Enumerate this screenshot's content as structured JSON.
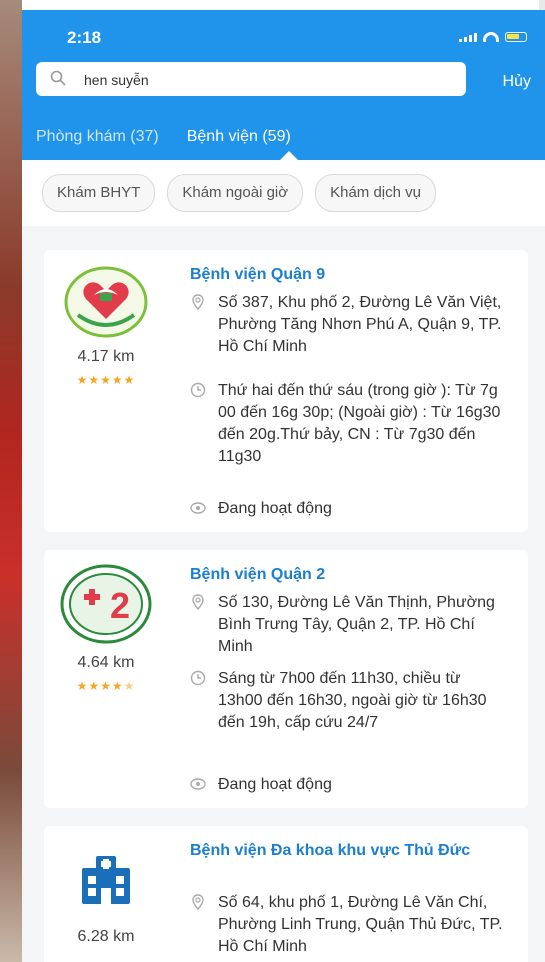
{
  "status_bar": {
    "time": "2:18"
  },
  "search": {
    "value": "hen suyễn",
    "cancel_label": "Hủy"
  },
  "tabs": [
    {
      "label": "Phòng khám (37)",
      "active": false
    },
    {
      "label": "Bệnh viện (59)",
      "active": true
    }
  ],
  "filters": [
    "Khám BHYT",
    "Khám ngoài giờ",
    "Khám dịch vụ"
  ],
  "hospitals": [
    {
      "name": "Bệnh viện Quận 9",
      "distance": "4.17 km",
      "rating": 5,
      "address": "Số 387, Khu phố 2, Đường Lê Văn Việt, Phường Tăng Nhơn Phú A, Quận 9, TP. Hồ Chí Minh",
      "hours": "Thứ hai đến thứ sáu (trong giờ ): Từ 7g 00 đến 16g 30p; (Ngoài giờ) : Từ 16g30 đến 20g.Thứ bảy, CN : Từ 7g30 đến 11g30",
      "status": "Đang hoạt động"
    },
    {
      "name": "Bệnh viện Quận 2",
      "distance": "4.64 km",
      "rating": 4.5,
      "address": "Số 130, Đường Lê Văn Thịnh, Phường Bình Trưng Tây, Quận 2, TP. Hồ Chí Minh",
      "hours": "Sáng từ 7h00 đến 11h30, chiều từ 13h00 đến 16h30, ngoài giờ từ 16h30 đến 19h, cấp cứu 24/7",
      "status": "Đang hoạt động"
    },
    {
      "name": "Bệnh viện Đa khoa khu vực Thủ Đức",
      "distance": "6.28 km",
      "address": "Số 64, khu phố 1, Đường Lê Văn Chí, Phường Linh Trung, Quận Thủ Đức, TP. Hồ Chí Minh"
    }
  ],
  "colors": {
    "header": "#1f94ea",
    "link": "#1b7fd0",
    "star": "#f5a623"
  }
}
